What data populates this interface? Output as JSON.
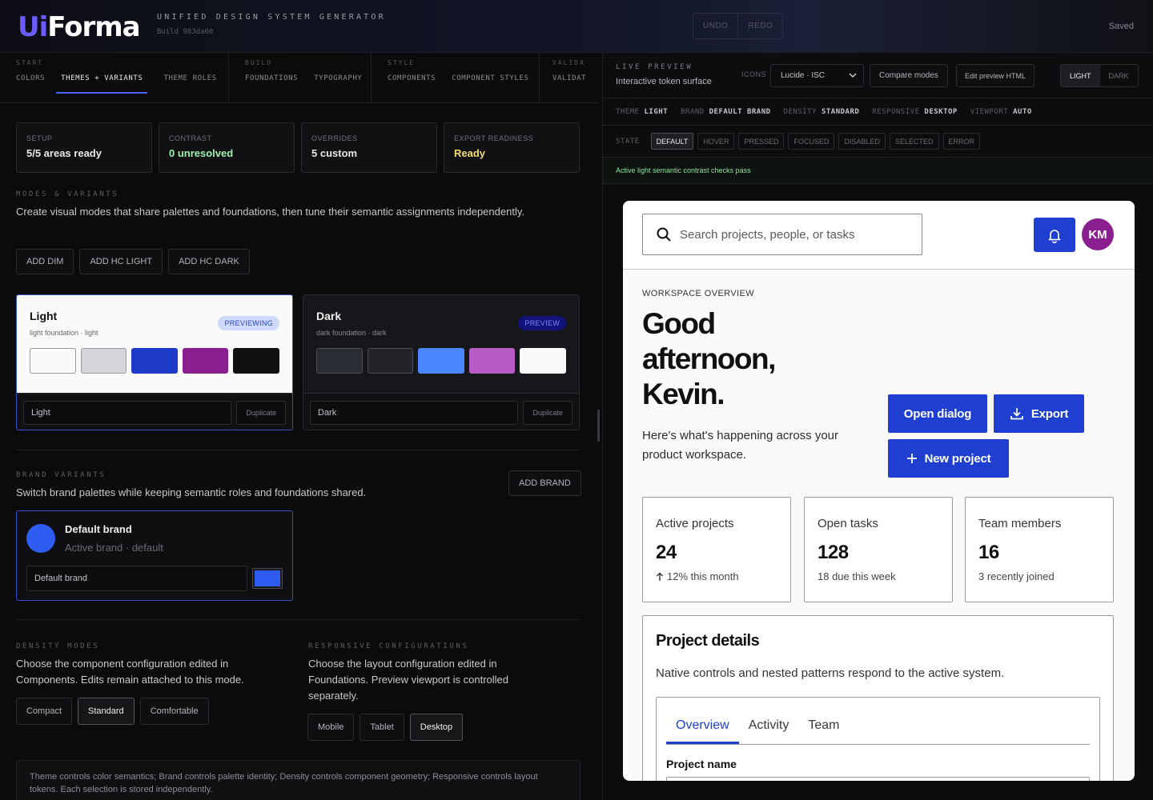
{
  "header": {
    "logo_ui": "Ui",
    "logo_forma": "Forma",
    "subtitle": "UNIFIED DESIGN SYSTEM GENERATOR",
    "build": "Build 983da60",
    "undo": "UNDO",
    "redo": "REDO",
    "saved": "Saved"
  },
  "nav": {
    "groups": [
      {
        "label": "START",
        "items": [
          "COLORS",
          "THEMES + VARIANTS",
          "THEME ROLES"
        ]
      },
      {
        "label": "BUILD",
        "items": [
          "FOUNDATIONS",
          "TYPOGRAPHY"
        ]
      },
      {
        "label": "STYLE",
        "items": [
          "COMPONENTS",
          "COMPONENT STYLES"
        ]
      },
      {
        "label": "VALIDA",
        "items": [
          "VALIDAT"
        ]
      }
    ],
    "active_item": "THEMES + VARIANTS"
  },
  "status_cards": [
    {
      "label": "SETUP",
      "value": "5/5 areas ready"
    },
    {
      "label": "CONTRAST",
      "value": "0 unresolved"
    },
    {
      "label": "OVERRIDES",
      "value": "5 custom"
    },
    {
      "label": "EXPORT READINESS",
      "value": "Ready"
    }
  ],
  "modes": {
    "label": "MODES & VARIANTS",
    "text": "Create visual modes that share palettes and foundations, then tune their semantic assignments independently.",
    "buttons": [
      "ADD DIM",
      "ADD HC LIGHT",
      "ADD HC DARK"
    ]
  },
  "themes": [
    {
      "name": "Light",
      "desc": "light foundation · light",
      "badge": "PREVIEWING",
      "swatches": [
        "#fafafa",
        "#d4d5da",
        "#1d3ac9",
        "#8a1f90",
        "#111111"
      ],
      "field": "Light",
      "duplicate": "Duplicate"
    },
    {
      "name": "Dark",
      "desc": "dark foundation · dark",
      "badge": "PREVIEW",
      "swatches": [
        "#2a2c33",
        "#22242a",
        "#4a86ff",
        "#b65cc4",
        "#fafafa"
      ],
      "field": "Dark",
      "duplicate": "Duplicate"
    }
  ],
  "brand": {
    "label": "BRAND VARIANTS",
    "text": "Switch brand palettes while keeping semantic roles and foundations shared.",
    "add": "ADD BRAND",
    "card_name": "Default brand",
    "card_sub": "Active brand · default",
    "field": "Default brand",
    "color": "#2f5cf0"
  },
  "density": {
    "label": "DENSITY MODES",
    "text": "Choose the component configuration edited in Components. Edits remain attached to this mode.",
    "options": [
      "Compact",
      "Standard",
      "Comfortable"
    ],
    "selected": "Standard"
  },
  "responsive": {
    "label": "RESPONSIVE CONFIGURATIONS",
    "text": "Choose the layout configuration edited in Foundations. Preview viewport is controlled separately.",
    "options": [
      "Mobile",
      "Tablet",
      "Desktop"
    ],
    "selected": "Desktop"
  },
  "footnote": "Theme controls color semantics; Brand controls palette identity; Density controls component geometry; Responsive controls layout tokens. Each selection is stored independently.",
  "preview": {
    "label": "LIVE PREVIEW",
    "sub": "Interactive token surface",
    "icons_label": "ICONS",
    "icon_set": "Lucide · ISC",
    "compare": "Compare modes",
    "edit": "Edit preview HTML",
    "modes": [
      "LIGHT",
      "DARK"
    ],
    "mode_selected": "LIGHT",
    "meta": [
      {
        "k": "THEME",
        "v": "LIGHT"
      },
      {
        "k": "BRAND",
        "v": "DEFAULT BRAND"
      },
      {
        "k": "DENSITY",
        "v": "STANDARD"
      },
      {
        "k": "RESPONSIVE",
        "v": "DESKTOP"
      },
      {
        "k": "VIEWPORT",
        "v": "AUTO"
      }
    ],
    "state_label": "STATE",
    "states": [
      "DEFAULT",
      "HOVER",
      "PRESSED",
      "FOCUSED",
      "DISABLED",
      "SELECTED",
      "ERROR"
    ],
    "state_selected": "DEFAULT",
    "notice": "Active light semantic contrast checks pass"
  },
  "surface": {
    "search_placeholder": "Search projects, people, or tasks",
    "avatar": "KM",
    "ws_label": "WORKSPACE OVERVIEW",
    "greeting": "Good afternoon, Kevin.",
    "desc": "Here's what's happening across your product workspace.",
    "open_dialog": "Open dialog",
    "export": "Export",
    "new_project": "New project",
    "stats": [
      {
        "title": "Active projects",
        "value": "24",
        "sub": "12% this month"
      },
      {
        "title": "Open tasks",
        "value": "128",
        "sub": "18 due this week"
      },
      {
        "title": "Team members",
        "value": "16",
        "sub": "3 recently joined"
      }
    ],
    "details_title": "Project details",
    "details_text": "Native controls and nested patterns respond to the active system.",
    "tabs": [
      "Overview",
      "Activity",
      "Team"
    ],
    "tab_selected": "Overview",
    "project_name_label": "Project name"
  }
}
